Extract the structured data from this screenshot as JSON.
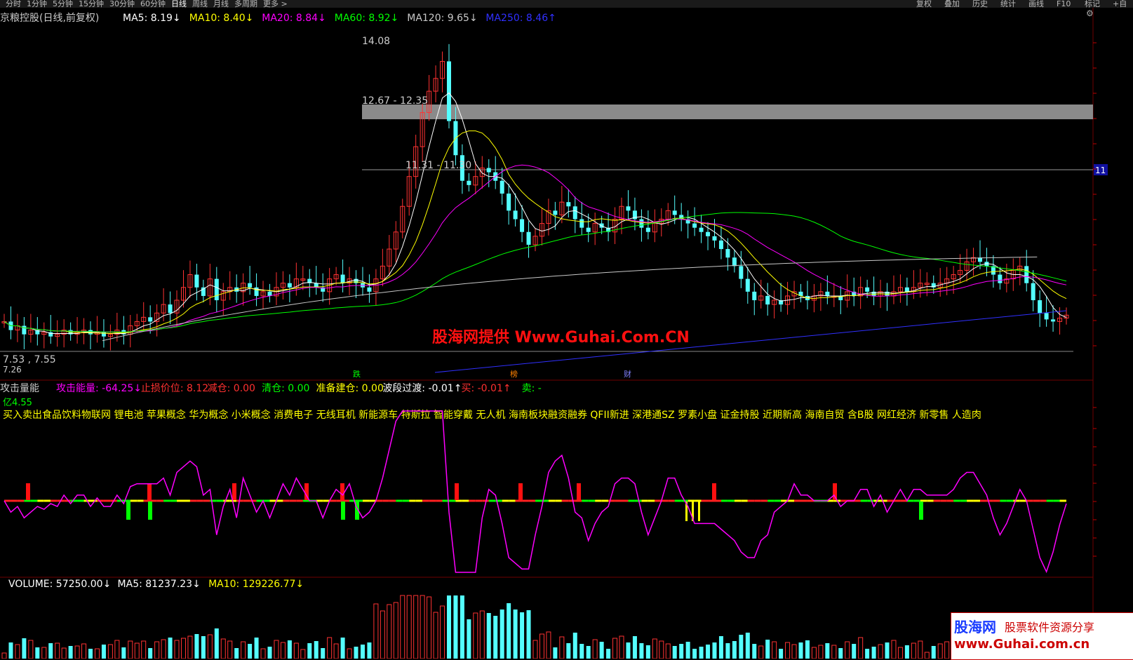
{
  "toolbar": {
    "periods": [
      "分时",
      "1分钟",
      "5分钟",
      "15分钟",
      "30分钟",
      "60分钟",
      "日线",
      "周线",
      "月线",
      "多周期",
      "更多 >"
    ],
    "active_period": "日线",
    "right_tools": [
      "复权",
      "叠加",
      "历史",
      "统计",
      "画线",
      "F10",
      "标记",
      "+自选"
    ]
  },
  "main_header": {
    "title": "京粮控股(日线,前复权)",
    "ma": [
      {
        "label": "MA5: 8.19",
        "arrow": "↓",
        "color": "#ffffff"
      },
      {
        "label": "MA10: 8.40",
        "arrow": "↓",
        "color": "#ffff00"
      },
      {
        "label": "MA20: 8.84",
        "arrow": "↓",
        "color": "#ff00ff"
      },
      {
        "label": "MA60: 8.92",
        "arrow": "↓",
        "color": "#00ff00"
      },
      {
        "label": "MA120: 9.65",
        "arrow": "↓",
        "color": "#c8c8c8"
      },
      {
        "label": "MA250: 8.46",
        "arrow": "↑",
        "color": "#3030ff"
      }
    ]
  },
  "price_chart": {
    "high_label": "14.08",
    "zone1_label": "12.67 - 12.35",
    "zone2_label": "11.31 - 11.30",
    "low_label": "7.53 , 7.55",
    "low_label2": "7.26",
    "right_tag": "11",
    "watermark": "股海网提供 Www.Guhai.Com.CN",
    "markers": [
      "跌",
      "榜",
      "财"
    ]
  },
  "indicator": {
    "name": "攻击量能",
    "fields": [
      {
        "label": "攻击能量: -64.25",
        "arrow": "↓",
        "color": "#ff00ff"
      },
      {
        "label": "止损价位: 8.12",
        "arrow": "",
        "color": "#ff3030"
      },
      {
        "label": "减仓: 0.00",
        "arrow": "",
        "color": "#ff3030"
      },
      {
        "label": "清仓: 0.00",
        "arrow": "",
        "color": "#00ff00"
      },
      {
        "label": "准备建仓: 0.00",
        "arrow": "",
        "color": "#ffff00"
      },
      {
        "label": "波段过渡: -0.01",
        "arrow": "↑",
        "color": "#ffffff"
      },
      {
        "label": "买: -0.01",
        "arrow": "↑",
        "color": "#ff3030"
      },
      {
        "label": "卖: -",
        "arrow": "",
        "color": "#00ff00"
      }
    ],
    "unit_label": "亿4.55",
    "concepts": "买入卖出食品饮料物联网 锂电池 苹果概念 华为概念 小米概念 消费电子 无线耳机 新能源车 特斯拉 智能穿戴 无人机 海南板块融资融券 QFII新进 深港通SZ 罗素小盘 证金持股 近期新高 海南自贸 含B股 网红经济 新零售 人造肉"
  },
  "volume": {
    "fields": [
      {
        "label": "VOLUME: 57250.00",
        "arrow": "↓",
        "color": "#ffffff"
      },
      {
        "label": "MA5: 81237.23",
        "arrow": "↓",
        "color": "#ffffff"
      },
      {
        "label": "MA10: 129226.77",
        "arrow": "↓",
        "color": "#ffff00"
      }
    ]
  },
  "logo": {
    "name": "股海网",
    "slogan": "股票软件资源分享",
    "url": "www.Guhai.com.cn"
  },
  "colors": {
    "up": "#ff3232",
    "down": "#54ffff",
    "ma5": "#ffffff",
    "ma10": "#ffff00",
    "ma20": "#ff00ff",
    "ma60": "#00ff00",
    "ma120": "#c8c8c8",
    "ma250": "#3030ff",
    "energy": "#ff00ff"
  },
  "chart_data": {
    "type": "candlestick",
    "price_ylim": [
      7.2,
      14.6
    ],
    "close": [
      7.9,
      7.7,
      7.8,
      7.6,
      7.7,
      7.6,
      7.65,
      7.55,
      7.6,
      7.7,
      7.6,
      7.65,
      7.7,
      7.6,
      7.65,
      7.55,
      7.6,
      7.7,
      7.6,
      7.8,
      7.9,
      8.0,
      7.9,
      8.1,
      8.3,
      8.1,
      8.4,
      8.7,
      9.0,
      8.7,
      8.5,
      8.9,
      8.4,
      8.6,
      8.7,
      8.6,
      8.8,
      8.7,
      8.5,
      8.6,
      8.5,
      8.7,
      8.8,
      8.7,
      8.9,
      8.9,
      8.8,
      8.7,
      8.6,
      8.9,
      9.0,
      8.8,
      8.9,
      8.8,
      8.7,
      8.6,
      8.9,
      9.2,
      9.6,
      10.0,
      10.6,
      11.3,
      12.0,
      12.8,
      13.3,
      13.6,
      14.0,
      12.6,
      11.8,
      11.2,
      11.1,
      11.3,
      11.5,
      11.4,
      11.2,
      10.9,
      10.5,
      10.3,
      10.0,
      9.7,
      9.9,
      10.2,
      10.5,
      10.4,
      10.7,
      10.6,
      10.3,
      10.1,
      10.0,
      10.2,
      10.1,
      10.0,
      10.3,
      10.6,
      10.5,
      10.3,
      10.1,
      10.0,
      10.2,
      10.3,
      10.5,
      10.4,
      10.3,
      10.2,
      10.1,
      10.0,
      9.9,
      9.8,
      9.6,
      9.4,
      9.2,
      8.9,
      8.6,
      8.4,
      8.5,
      8.3,
      8.4,
      8.3,
      8.5,
      8.6,
      8.5,
      8.4,
      8.5,
      8.6,
      8.5,
      8.5,
      8.4,
      8.6,
      8.5,
      8.7,
      8.6,
      8.5,
      8.6,
      8.5,
      8.6,
      8.7,
      8.6,
      8.7,
      8.8,
      8.8,
      8.7,
      8.8,
      8.9,
      9.0,
      9.1,
      9.3,
      9.4,
      9.3,
      9.2,
      9.0,
      8.8,
      8.9,
      9.1,
      9.2,
      8.8,
      8.4,
      8.1,
      7.95,
      7.9,
      7.98,
      8.05
    ]
  }
}
